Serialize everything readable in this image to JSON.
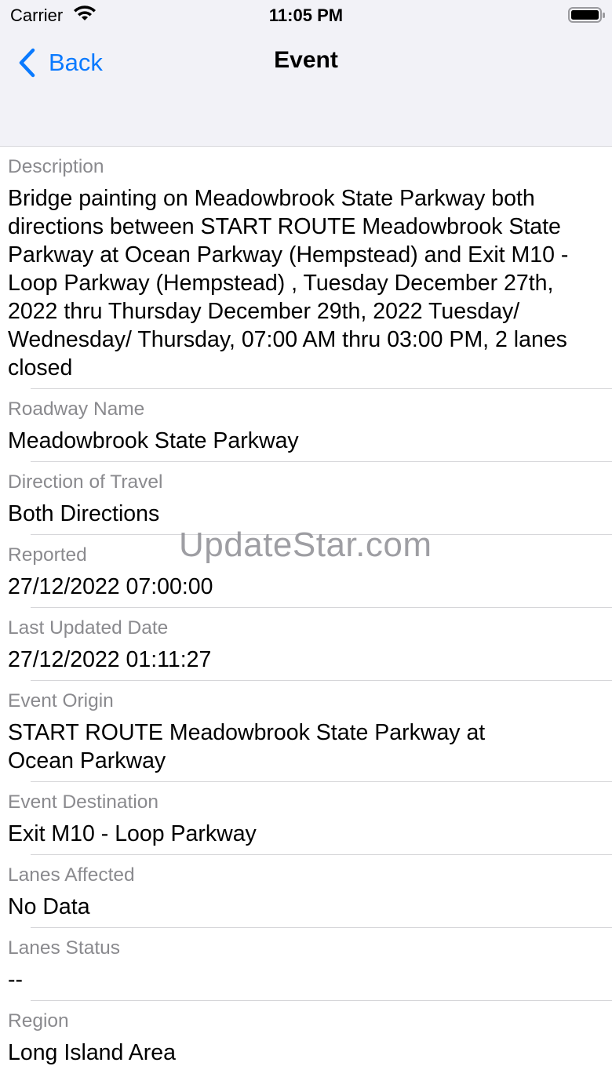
{
  "status_bar": {
    "carrier": "Carrier",
    "time": "11:05 PM"
  },
  "nav": {
    "back_label": "Back",
    "title": "Event",
    "accent_color": "#0a7aff"
  },
  "rows": [
    {
      "label": "Description",
      "value": "Bridge painting on Meadowbrook State Parkway both directions between START ROUTE Meadowbrook State Parkway at Ocean Parkway (Hempstead) and Exit M10 - Loop Parkway (Hempstead) , Tuesday December 27th, 2022 thru Thursday December 29th, 2022 Tuesday/ Wednesday/ Thursday, 07:00 AM thru 03:00 PM, 2 lanes closed"
    },
    {
      "label": "Roadway Name",
      "value": "Meadowbrook State Parkway"
    },
    {
      "label": "Direction of Travel",
      "value": "Both Directions"
    },
    {
      "label": "Reported",
      "value": "27/12/2022 07:00:00"
    },
    {
      "label": "Last Updated Date",
      "value": "27/12/2022 01:11:27"
    },
    {
      "label": "Event Origin",
      "value": "START ROUTE Meadowbrook State Parkway at Ocean Parkway"
    },
    {
      "label": "Event Destination",
      "value": "Exit M10 - Loop Parkway"
    },
    {
      "label": "Lanes Affected",
      "value": "No Data"
    },
    {
      "label": "Lanes Status",
      "value": "--"
    },
    {
      "label": "Region",
      "value": "Long Island Area"
    }
  ],
  "watermark": "UpdateStar.com"
}
